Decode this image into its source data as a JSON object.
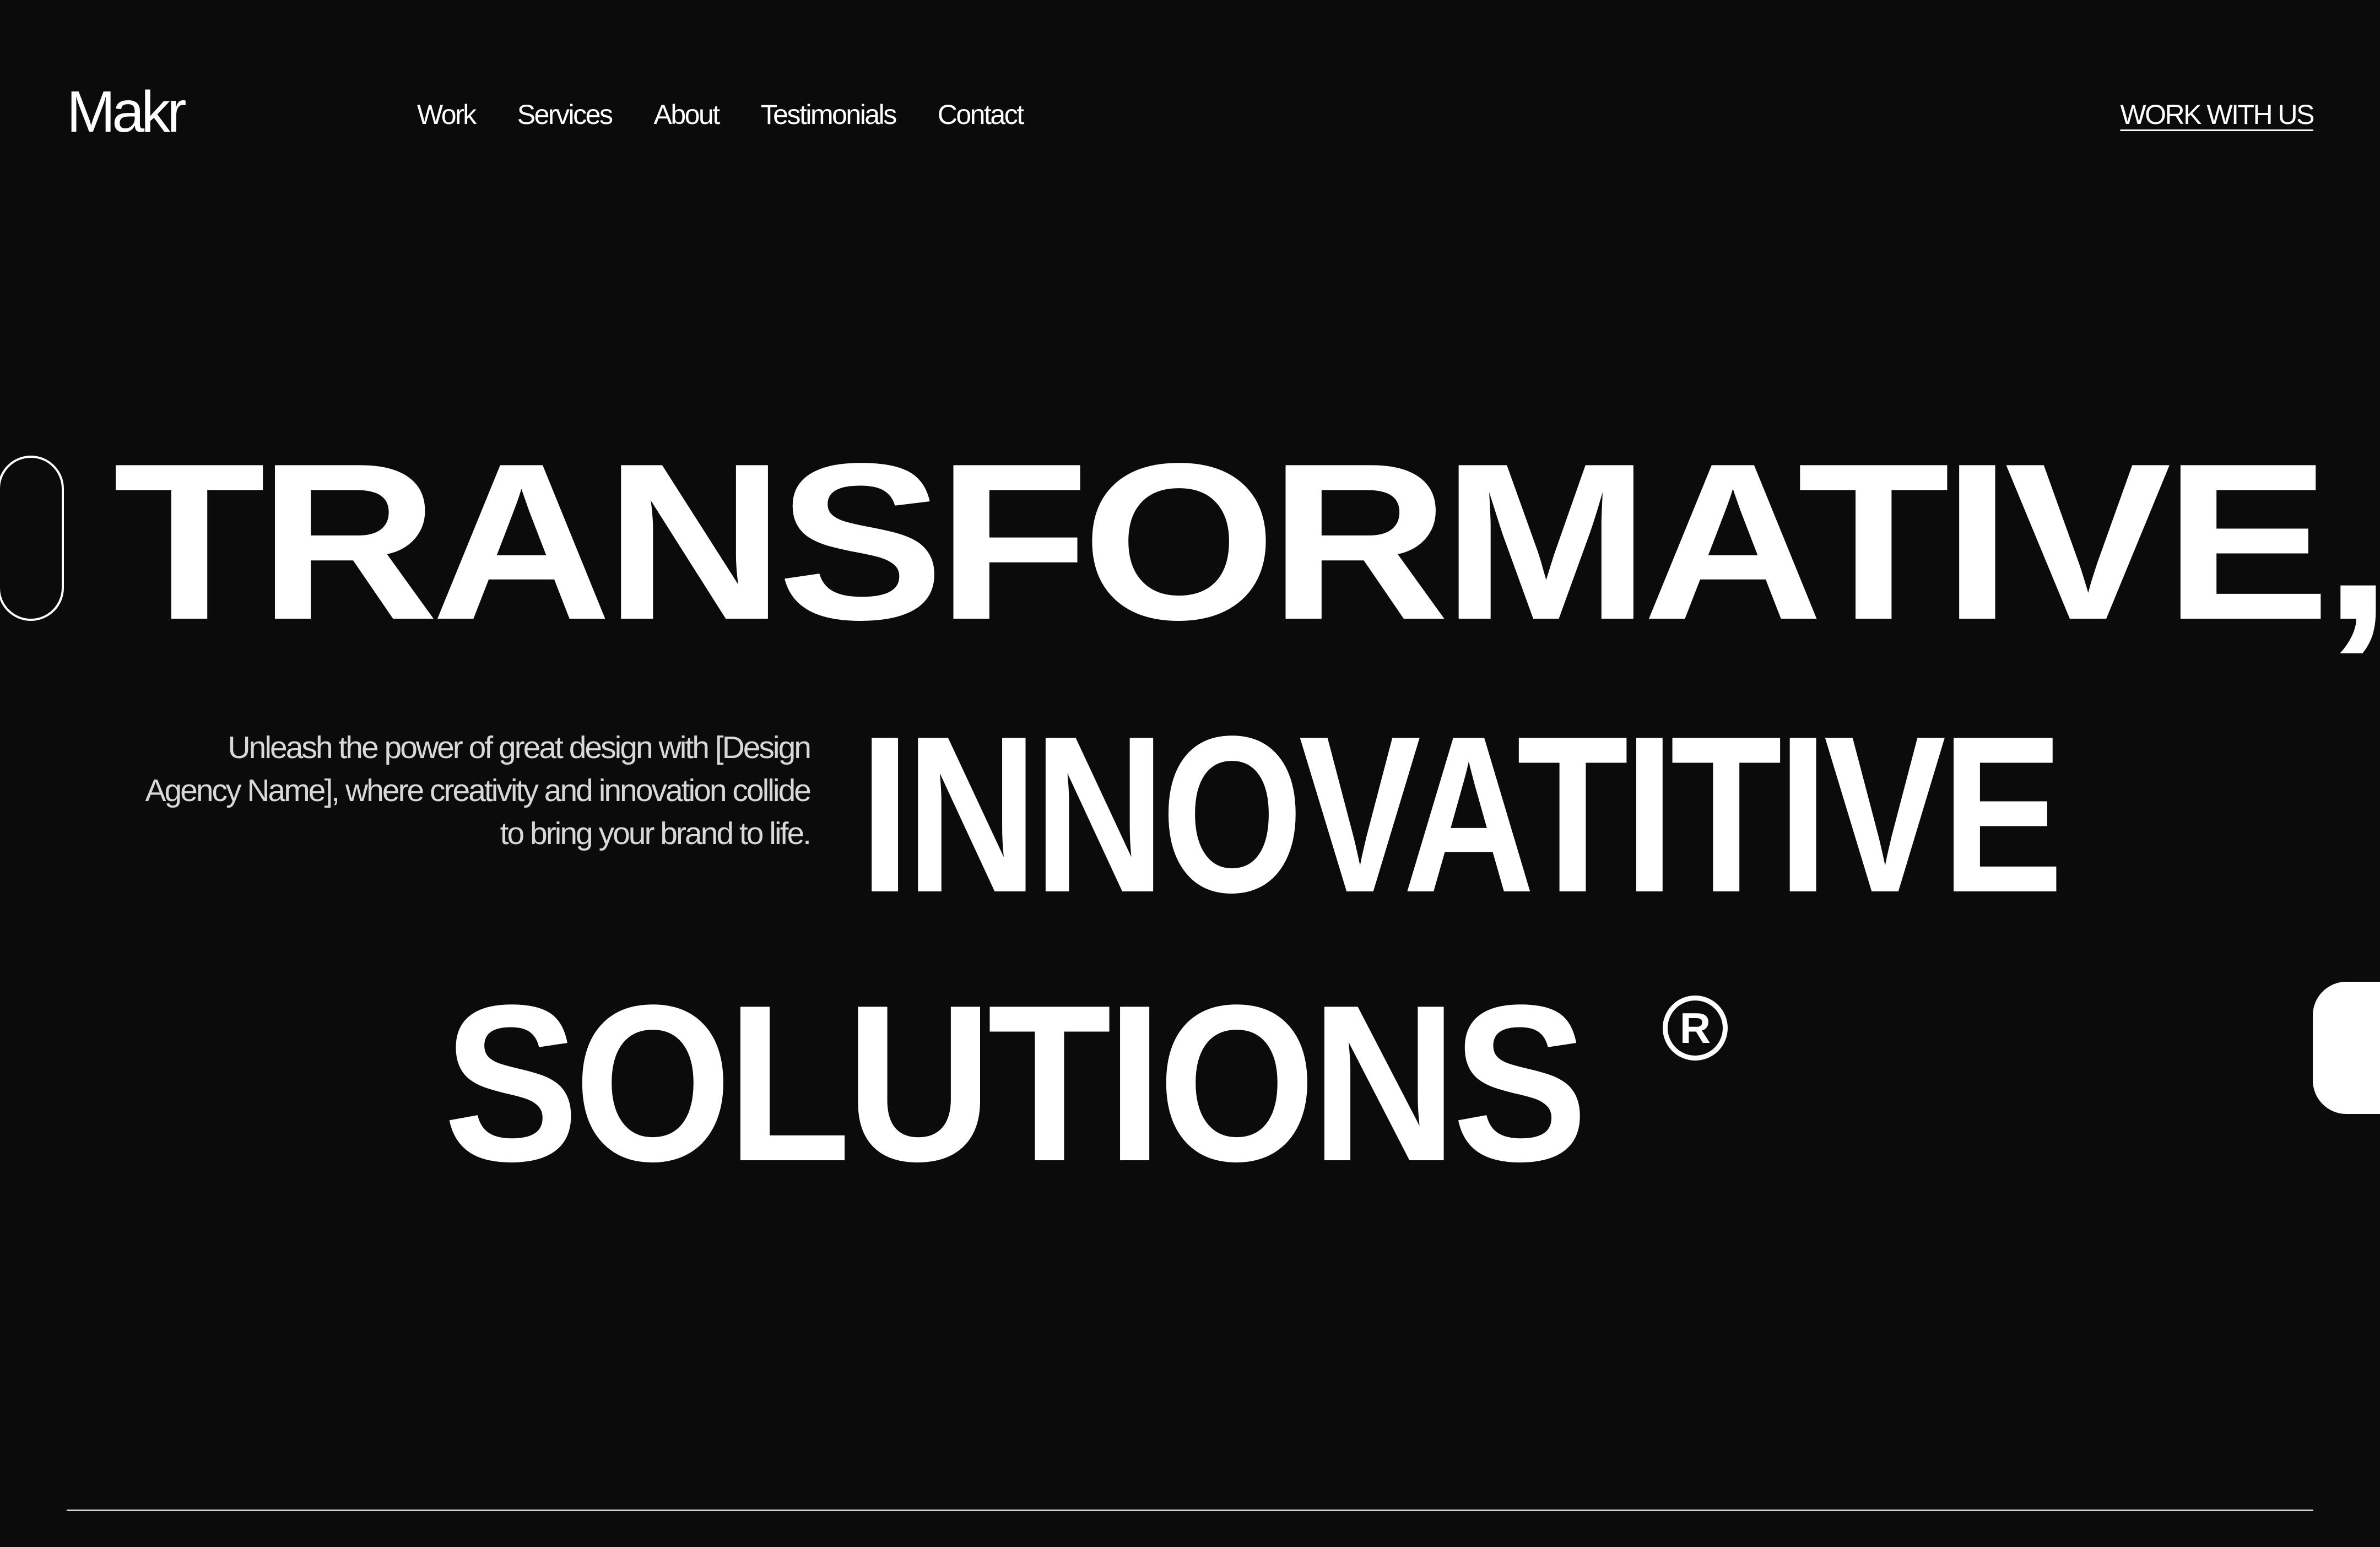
{
  "brand": {
    "logo_text": "Makr"
  },
  "nav": {
    "items": [
      {
        "label": "Work"
      },
      {
        "label": "Services"
      },
      {
        "label": "About"
      },
      {
        "label": "Testimonials"
      },
      {
        "label": "Contact"
      }
    ],
    "cta_label": "WORK WITH US"
  },
  "hero": {
    "line_1": "TRANSFORMATIVE,",
    "line_2": "INNOVATITIVE",
    "line_3": "SOLUTIONS",
    "registered_mark": "R",
    "tagline": "Unleash the power of great design with [Design Agency Name], where creativity and innovation collide to bring your brand to life."
  },
  "colors": {
    "background": "#0b0b0b",
    "text": "#ffffff",
    "muted_text": "#d8d8d8"
  }
}
